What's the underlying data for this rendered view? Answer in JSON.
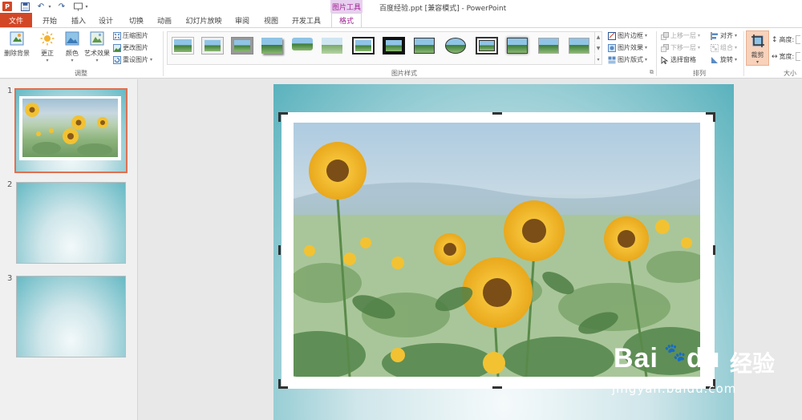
{
  "app": {
    "icon_letter": "P",
    "context_tab_group": "图片工具",
    "document_title": "百度经验.ppt [兼容模式] - PowerPoint"
  },
  "qat": {
    "save_icon": "save-icon",
    "undo_icon": "undo-icon",
    "redo_icon": "redo-icon",
    "slideshow_icon": "slideshow-icon"
  },
  "tabs": [
    "文件",
    "开始",
    "插入",
    "设计",
    "切换",
    "动画",
    "幻灯片放映",
    "审阅",
    "视图",
    "开发工具",
    "格式"
  ],
  "ribbon": {
    "adjust": {
      "remove_bg": "删除背景",
      "corrections": "更正",
      "color": "颜色",
      "artistic": "艺术效果",
      "compress": "压缩图片",
      "change": "更改图片",
      "reset": "重设图片",
      "label": "调整"
    },
    "styles": {
      "border": "图片边框",
      "effects": "图片效果",
      "layout": "图片版式",
      "label": "图片样式"
    },
    "arrange": {
      "bring_forward": "上移一层",
      "send_backward": "下移一层",
      "selection_pane": "选择窗格",
      "align": "对齐",
      "group": "组合",
      "rotate": "旋转",
      "label": "排列"
    },
    "size": {
      "crop": "裁剪",
      "height": "高度:",
      "width": "宽度:",
      "label": "大小"
    }
  },
  "slides": [
    {
      "number": "1"
    },
    {
      "number": "2"
    },
    {
      "number": "3"
    }
  ],
  "watermark": {
    "brand": "Bai",
    "paw": "du",
    "cn": "经验",
    "url": "jingyan.baidu.com"
  },
  "colors": {
    "accent": "#d24726",
    "context": "#a02090",
    "slide_teal": "#5ab2bd"
  }
}
